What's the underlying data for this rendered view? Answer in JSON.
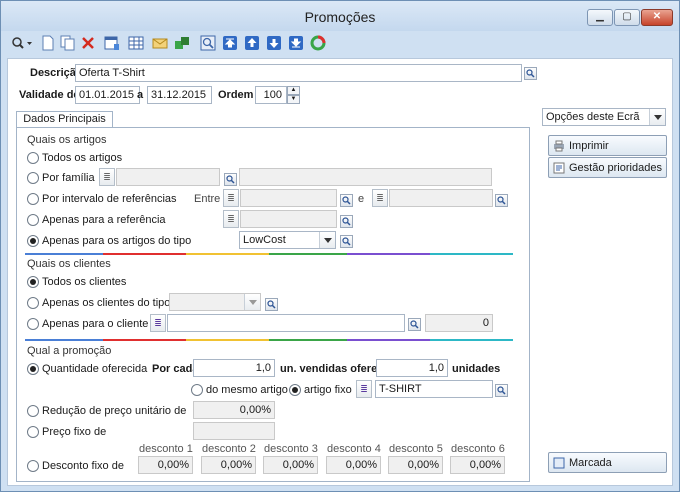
{
  "window": {
    "title": "Promoções"
  },
  "toolbar": {
    "icons": [
      "search-icon",
      "new-document-icon",
      "copy-icon",
      "delete-icon",
      "properties-icon",
      "grid-icon",
      "mail-icon",
      "refresh-data-icon",
      "preview-icon",
      "move-top-icon",
      "move-up-icon",
      "move-down-icon",
      "move-bottom-icon",
      "reload-icon"
    ]
  },
  "header": {
    "descricao_label": "Descrição",
    "descricao_value": "Oferta T-Shirt",
    "validade_label": "Validade de",
    "validade_from": "01.01.2015",
    "validade_sep": "a",
    "validade_to": "31.12.2015",
    "ordem_label": "Ordem",
    "ordem_value": "100"
  },
  "tabs": [
    {
      "label": "Dados Principais"
    }
  ],
  "artigos": {
    "title": "Quais os artigos",
    "opt_todos": "Todos os artigos",
    "opt_familia": "Por família",
    "opt_intervalo": "Por intervalo de referências",
    "entre_label": "Entre",
    "e_label": "e",
    "opt_referencia": "Apenas para a referência",
    "opt_tipo": "Apenas para os artigos do tipo",
    "tipo_value": "LowCost"
  },
  "clientes": {
    "title": "Quais os clientes",
    "opt_todos": "Todos os clientes",
    "opt_tipo": "Apenas os clientes do tipo",
    "opt_cliente": "Apenas para o cliente",
    "cliente_count": "0"
  },
  "promocao": {
    "title": "Qual a promoção",
    "opt_quantidade": "Quantidade oferecida",
    "por_cada_label": "Por cada",
    "por_cada_value": "1,0",
    "un_vendidas_label": "un. vendidas oferece",
    "oferece_value": "1,0",
    "unidades_label": "unidades",
    "opt_mesmo_artigo": "do mesmo artigo",
    "opt_artigo_fixo": "artigo fixo",
    "artigo_fixo_value": "T-SHIRT",
    "opt_reducao": "Redução de preço unitário de",
    "reducao_value": "0,00%",
    "opt_preco_fixo": "Preço fixo de",
    "preco_fixo_value": "",
    "opt_desconto_fixo": "Desconto fixo de",
    "descontos": [
      {
        "label": "desconto 1",
        "value": "0,00%"
      },
      {
        "label": "desconto 2",
        "value": "0,00%"
      },
      {
        "label": "desconto 3",
        "value": "0,00%"
      },
      {
        "label": "desconto 4",
        "value": "0,00%"
      },
      {
        "label": "desconto 5",
        "value": "0,00%"
      },
      {
        "label": "desconto 6",
        "value": "0,00%"
      }
    ]
  },
  "sidepanel": {
    "options_label": "Opções deste Ecrã",
    "imprimir": "Imprimir",
    "gestao": "Gestão prioridades",
    "marcada": "Marcada"
  },
  "colors": {
    "accent": "#b33a2a",
    "window_bg": "#cfe0f2"
  }
}
